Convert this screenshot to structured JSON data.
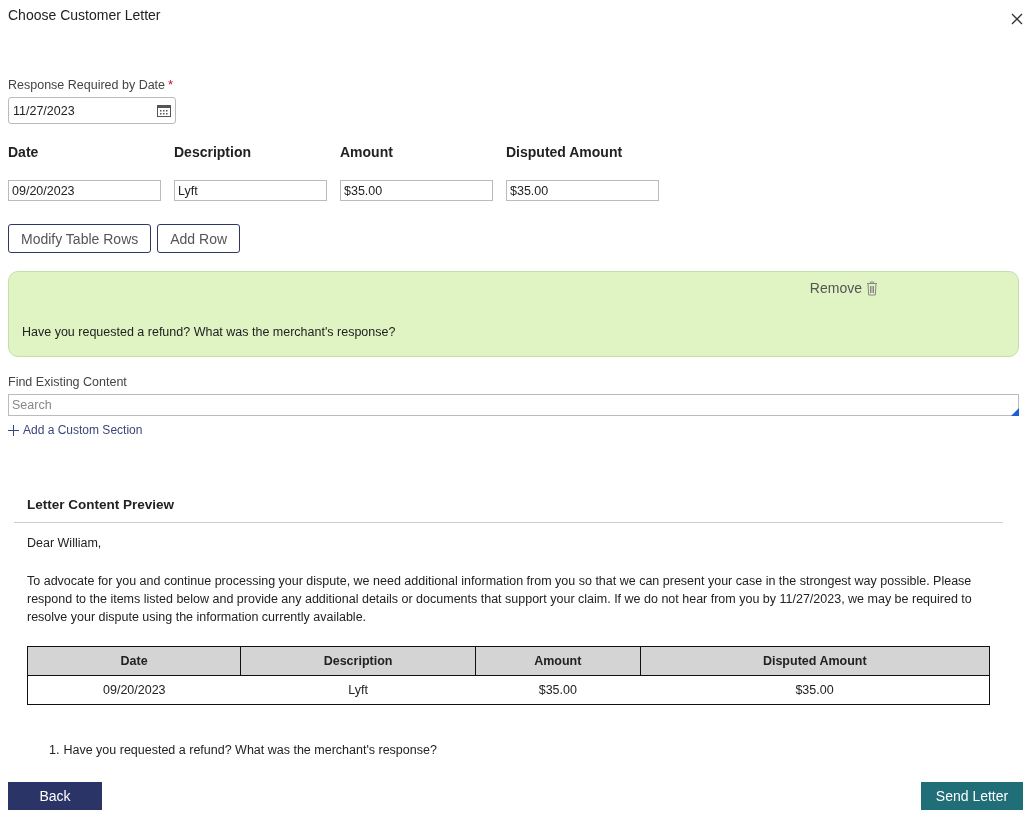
{
  "window": {
    "title": "Choose Customer Letter"
  },
  "response_date": {
    "label": "Response Required by Date",
    "required_mark": "*",
    "value": "11/27/2023"
  },
  "items_form": {
    "columns": [
      "Date",
      "Description",
      "Amount",
      "Disputed Amount"
    ],
    "rows": [
      [
        "09/20/2023",
        "Lyft",
        "$35.00",
        "$35.00"
      ]
    ]
  },
  "form_buttons": [
    "Modify Table Rows",
    "Add Row"
  ],
  "sections": [
    {
      "remove_label": "Remove",
      "text": "Have you requested a refund? What was the merchant's response?"
    }
  ],
  "find_content": {
    "label": "Find Existing Content",
    "placeholder": "Search"
  },
  "add_section": {
    "label": "Add a Custom Section"
  },
  "preview": {
    "title": "Letter Content Preview",
    "greeting": "Dear William,",
    "paragraph": "To advocate for you and continue processing your dispute, we need additional information from you so that we can present your case in the strongest way possible. Please respond to the items listed below and provide any additional details or documents that support your claim. If we do not hear from you by 11/27/2023, we may be required to resolve your dispute using the information currently available.",
    "table": {
      "columns": [
        "Date",
        "Description",
        "Amount",
        "Disputed Amount"
      ],
      "rows": [
        [
          "09/20/2023",
          "Lyft",
          "$35.00",
          "$35.00"
        ]
      ]
    },
    "questions": [
      {
        "number": "1.",
        "text": "Have you requested a refund? What was the merchant's response?"
      }
    ]
  },
  "footer": {
    "back": "Back",
    "send": "Send Letter"
  }
}
